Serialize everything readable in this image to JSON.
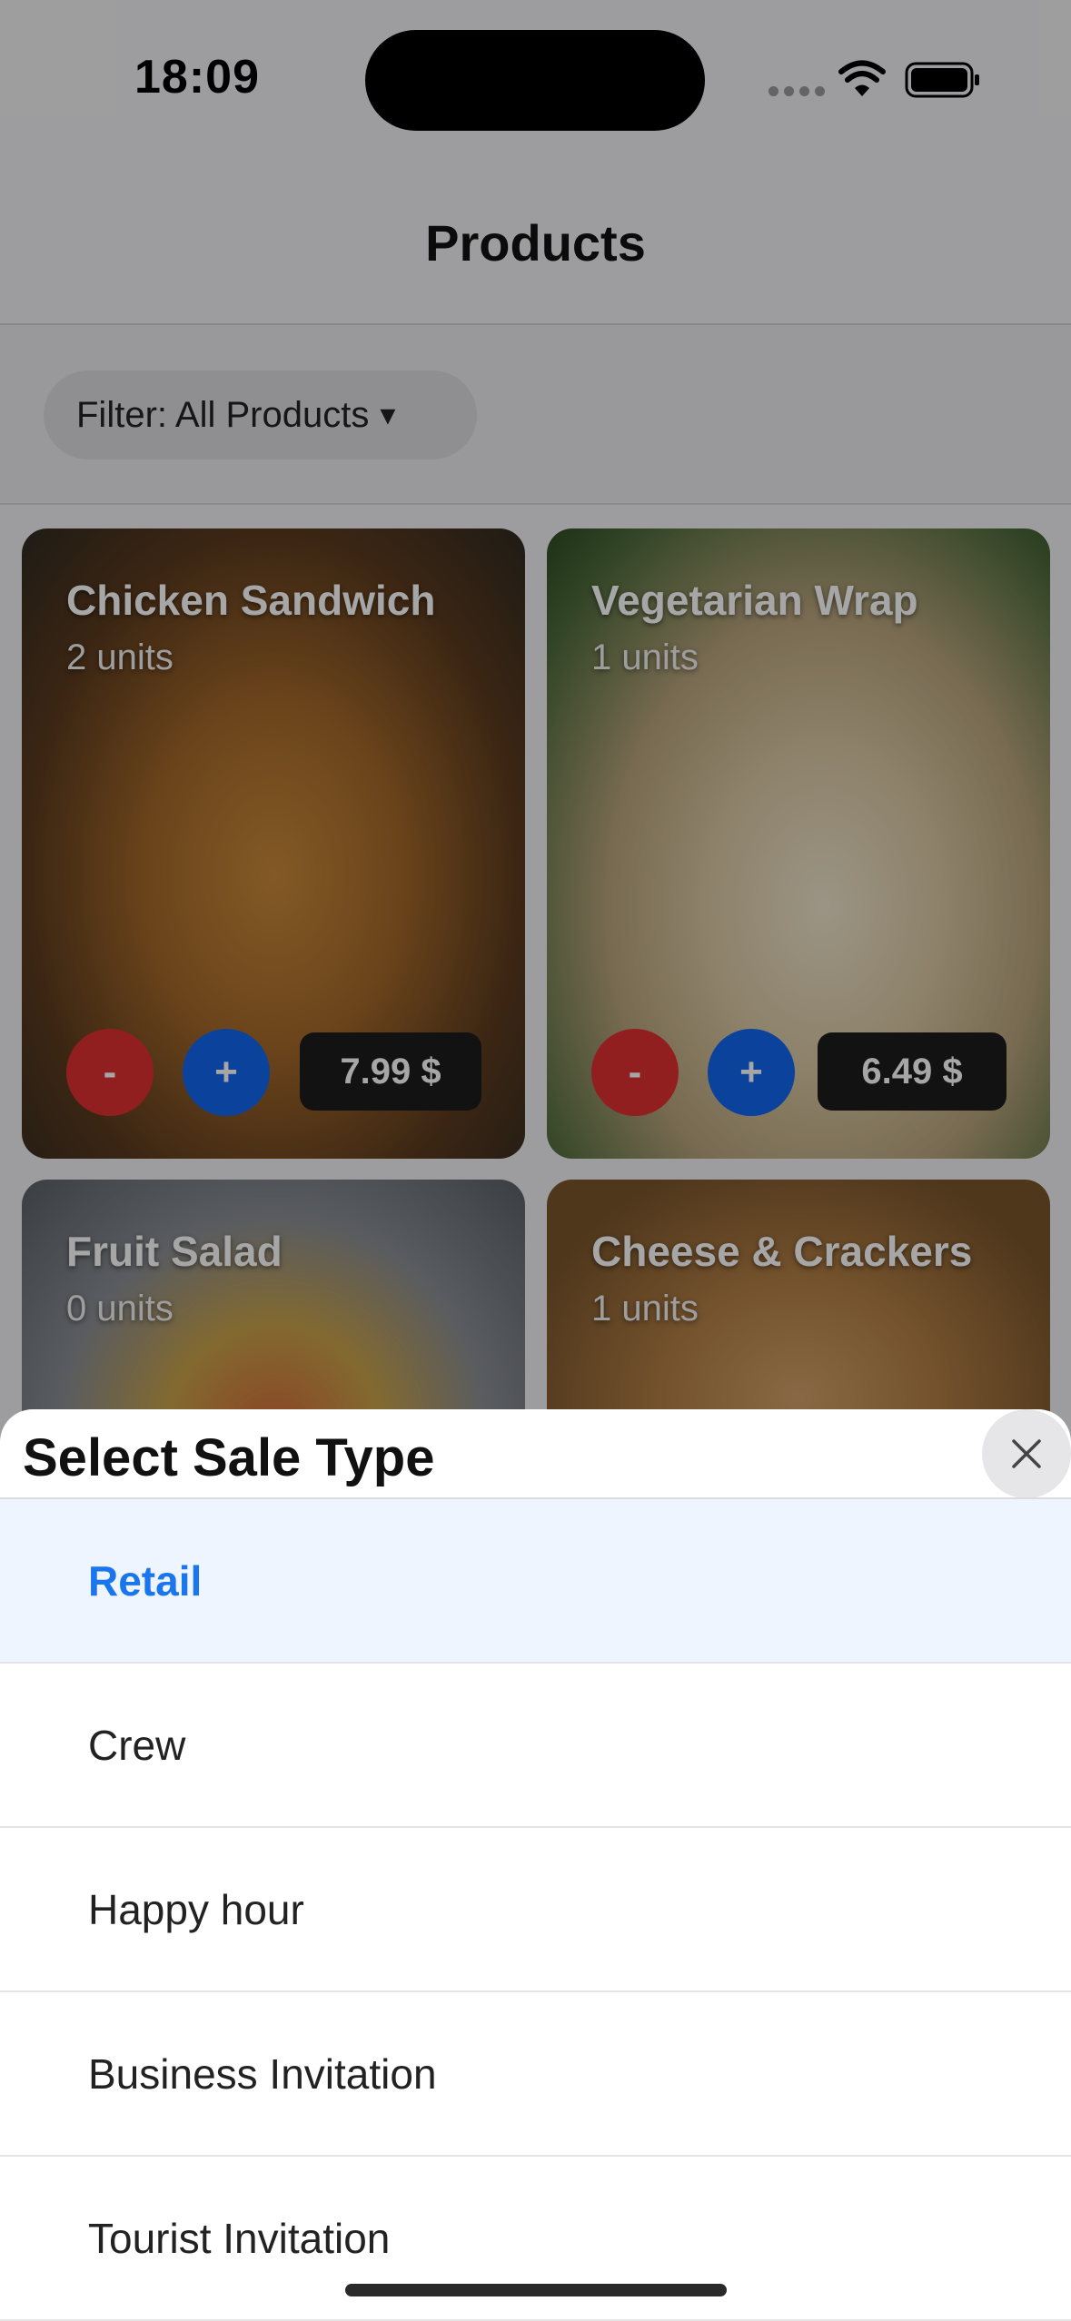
{
  "status_bar": {
    "time": "18:09"
  },
  "header": {
    "title": "Products"
  },
  "filter": {
    "label": "Filter: All Products",
    "caret": "▾"
  },
  "products": [
    {
      "name": "Chicken Sandwich",
      "units": "2 units",
      "minus": "-",
      "plus": "+",
      "price": "7.99 $"
    },
    {
      "name": "Vegetarian Wrap",
      "units": "1 units",
      "minus": "-",
      "plus": "+",
      "price": "6.49 $"
    },
    {
      "name": "Fruit Salad",
      "units": "0 units"
    },
    {
      "name": "Cheese & Crackers",
      "units": "1 units"
    }
  ],
  "sheet": {
    "title": "Select Sale Type",
    "options": [
      {
        "label": "Retail",
        "selected": true
      },
      {
        "label": "Crew"
      },
      {
        "label": "Happy hour"
      },
      {
        "label": "Business Invitation"
      },
      {
        "label": "Tourist Invitation"
      }
    ]
  },
  "colors": {
    "accent": "#1a76ee",
    "minus": "#e03030",
    "plus": "#1166ee",
    "selected_bg": "#eef5ff"
  }
}
